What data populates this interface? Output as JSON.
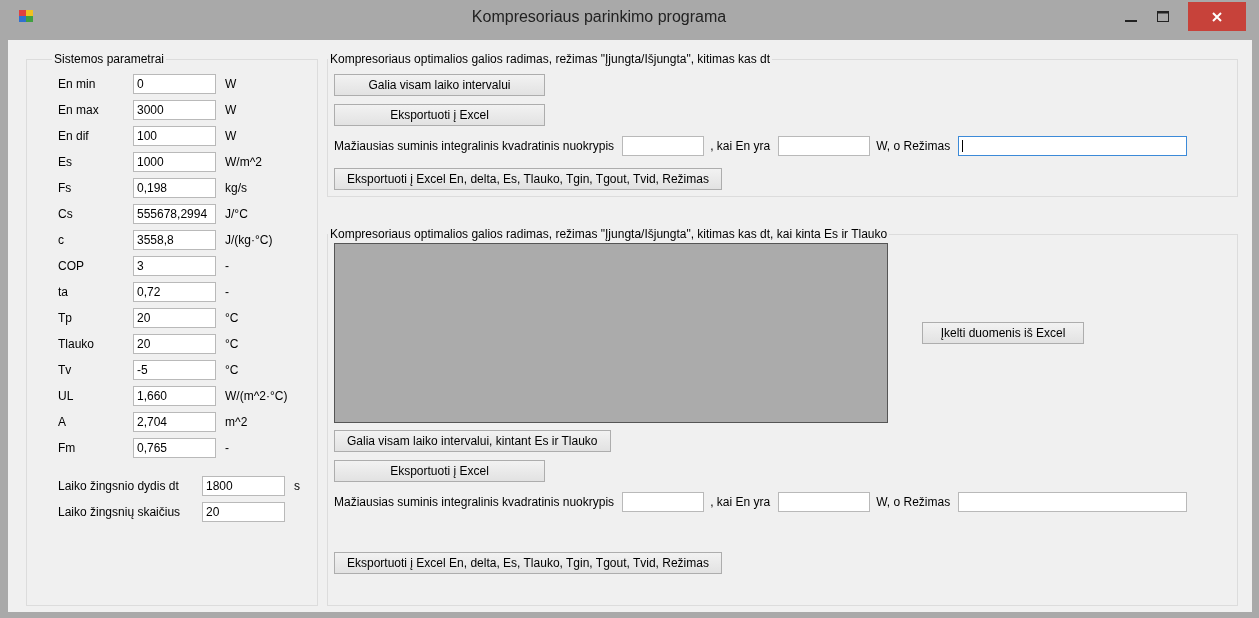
{
  "window": {
    "title": "Kompresoriaus parinkimo programa"
  },
  "parameters": {
    "title": "Sistemos parametrai",
    "rows": [
      {
        "label": "En min",
        "value": "0",
        "unit": "W"
      },
      {
        "label": "En max",
        "value": "3000",
        "unit": "W"
      },
      {
        "label": "En dif",
        "value": "100",
        "unit": "W"
      },
      {
        "label": "Es",
        "value": "1000",
        "unit": "W/m^2"
      },
      {
        "label": "Fs",
        "value": "0,198",
        "unit": "kg/s"
      },
      {
        "label": "Cs",
        "value": "555678,2994",
        "unit": "J/°C"
      },
      {
        "label": "c",
        "value": "3558,8",
        "unit": "J/(kg·°C)"
      },
      {
        "label": "COP",
        "value": "3",
        "unit": "-"
      },
      {
        "label": "ta",
        "value": "0,72",
        "unit": "-"
      },
      {
        "label": "Tp",
        "value": "20",
        "unit": "°C"
      },
      {
        "label": "Tlauko",
        "value": "20",
        "unit": "°C"
      },
      {
        "label": "Tv",
        "value": "-5",
        "unit": "°C"
      },
      {
        "label": "UL",
        "value": "1,660",
        "unit": "W/(m^2·°C)"
      },
      {
        "label": "A",
        "value": "2,704",
        "unit": "m^2"
      },
      {
        "label": "Fm",
        "value": "0,765",
        "unit": "-"
      }
    ],
    "steps": [
      {
        "label": "Laiko žingsnio dydis dt",
        "value": "1800",
        "unit": "s"
      },
      {
        "label": "Laiko žingsnių skaičius",
        "value": "20"
      }
    ]
  },
  "sections": [
    {
      "title": "Kompresoriaus optimalios galios radimas, režimas \"Įjungta/Išjungta\", kitimas kas dt",
      "buttons": [
        "Galia visam laiko intervalui",
        "Eksportuoti į Excel"
      ],
      "result": [
        {
          "kind": "text",
          "text": "Mažiausias suminis integralinis kvadratinis nuokrypis"
        },
        {
          "kind": "field",
          "focused": false
        },
        {
          "kind": "text",
          "text": ", kai En yra"
        },
        {
          "kind": "field",
          "focused": false
        },
        {
          "kind": "text",
          "text": "W, o Režimas"
        },
        {
          "kind": "field",
          "focused": true
        }
      ],
      "export": "Eksportuoti į Excel En, delta, Es, Tlauko, Tgin, Tgout, Tvid, Režimas"
    },
    {
      "title": "Kompresoriaus optimalios galios radimas, režimas \"Įjungta/Išjungta\", kitimas kas dt, kai kinta Es ir Tlauko",
      "grid": {
        "button": "Įkelti duomenis iš Excel"
      },
      "buttons": [
        "Galia visam laiko intervalui, kintant Es ir Tlauko",
        "Eksportuoti į Excel"
      ],
      "result": [
        {
          "kind": "text",
          "text": "Mažiausias suminis integralinis kvadratinis nuokrypis"
        },
        {
          "kind": "field",
          "focused": false
        },
        {
          "kind": "text",
          "text": ", kai En yra"
        },
        {
          "kind": "field",
          "focused": false
        },
        {
          "kind": "text",
          "text": "W, o Režimas"
        },
        {
          "kind": "field",
          "focused": false
        }
      ],
      "export": "Eksportuoti į Excel En, delta, Es, Tlauko, Tgin, Tgout, Tvid, Režimas"
    }
  ]
}
